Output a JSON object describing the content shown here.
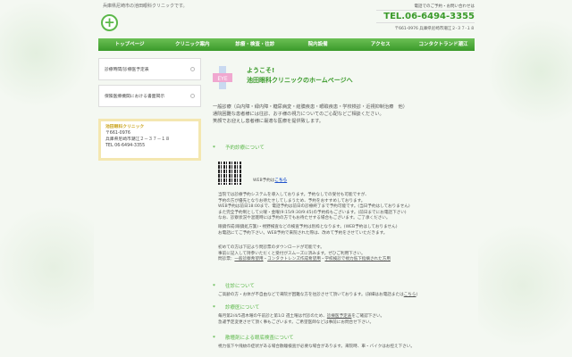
{
  "header": {
    "tagline": "兵庫県尼崎市の池田眼科クリニックです。",
    "phone_note": "電話でのご予約・お問い合わせは",
    "phone": "TEL.06-6494-3355",
    "address": "〒661-0976 兵庫県尼崎市潮江２-３７-１８"
  },
  "nav": [
    "トップページ",
    "クリニック案内",
    "診療・検査・往診",
    "院内設備",
    "アクセス",
    "コンタクトランド潮江"
  ],
  "sidebar": {
    "links": [
      "診療時間/診療医予定表",
      "保険医療機関における書面掲示"
    ],
    "info": {
      "title": "池田眼科クリニック",
      "zip": "〒661-0976",
      "address": "兵庫県尼崎市潮江２－３７－１８",
      "tel": "TEL 06-6494-3355"
    }
  },
  "main": {
    "welcome1": "ようこそ!",
    "welcome2": "池田眼科クリニックのホームページへ",
    "intro": [
      "一般診療（白内障・緑内障・糖尿病変・結膜疾患・眼瞼疾患・学校検診・近視抑制治療　他）",
      "通院困難な患者様には往診、お子様の視力についてのご心配などご相談ください。",
      "笑顔でお迎えし患者様に最適な医療を提供致します。"
    ],
    "s1": {
      "title": "予約診療について",
      "web": "WEB予約は",
      "web_link": "こちら",
      "p1": [
        "当院では診療予約システムを導入しております。予約なしでの受付も可能ですが、",
        "予約の方が優先となりお待たせしてしまうため、予約をおすすめしております。",
        "WEB予約は前日18:00まで、電話予約は前日の診療終了まで予約可能です。(当日予約はしておりません)",
        "また完全予約制として火曜・金曜(9:15/9:30/9:45)の予約枠もございます。(前日までにお電話下さい)",
        "なお、診察状況や混雑時には予約の方でもお待たせする場合もございます。ご了承ください。"
      ],
      "p2": [
        "眼鏡作成(眼鏡処方箋)・視野検査などの検査予約は別枠となります。(WEB予約はしておりません)",
        "お電話にてご予約下さい。WEB予約で来院された際は、改めて予約をさせていただきます。"
      ],
      "p3": [
        "初めての方は下記より問診票のダウンロードが可能です。",
        "事前に記入して持参いただくと受付がスムーズに済みます。ぜひご利用下さい。"
      ],
      "forms_label": "問診票：",
      "forms": [
        "一般診察希望用",
        "コンタクトレンズ作成希望用",
        "学校検診で視力低下指摘された方用"
      ]
    },
    "s2": {
      "title": "往診について",
      "text": "ご高齢の方・お体が不自由などで来院が困難な方を往診させて頂いております。(詳細はお電話または",
      "link": "こちら",
      "end": ")"
    },
    "s3": {
      "title": "診療医について",
      "l1a": "毎月第2/4/5週木曜の午前診と第1/2 週土曜は代診のため、",
      "l1link": "診療医予定表",
      "l1b": "をご確認下さい。",
      "l2": "急遽予定変更させて頂く事もございます。ご希望医師などは事前にお問合せ下さい。"
    },
    "s4": {
      "title": "散瞳剤による眼底検査について",
      "text": "視力低下や飛蚊の症状がある場合散瞳検査が必要な場合があります。来院時、車・バイクはお控え下さい。"
    }
  },
  "colors": {
    "accent": "#3a9a2a",
    "link": "#2255cc"
  }
}
